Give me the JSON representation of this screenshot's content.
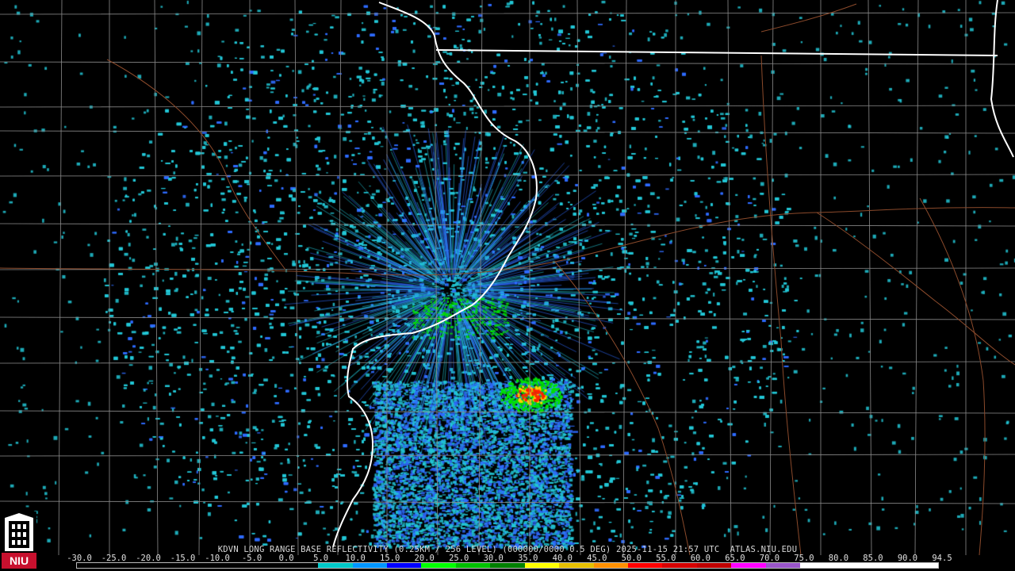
{
  "product": {
    "station": "KDVN",
    "description": "LONG RANGE BASE REFLECTIVITY (0.25KM / 256 LEVEL) (000000/0000 0.5 DEG)",
    "timestamp": "2025-11-15 21:57 UTC",
    "source": "ATLAS.NIU.EDU"
  },
  "colorscale": {
    "labels": [
      "-30.0",
      "-25.0",
      "-20.0",
      "-15.0",
      "-10.0",
      "-5.0",
      "0.0",
      "5.0",
      "10.0",
      "15.0",
      "20.0",
      "25.0",
      "30.0",
      "35.0",
      "40.0",
      "45.0",
      "50.0",
      "55.0",
      "60.0",
      "65.0",
      "70.0",
      "75.0",
      "80.0",
      "85.0",
      "90.0",
      "94.5"
    ],
    "colors": [
      "#000000",
      "#000000",
      "#000000",
      "#000000",
      "#000000",
      "#000000",
      "#000000",
      "#00c8c8",
      "#0096ff",
      "#0000ff",
      "#00ff00",
      "#00c000",
      "#008000",
      "#ffff00",
      "#e7c000",
      "#ff9000",
      "#ff0000",
      "#d60000",
      "#c00000",
      "#ff00ff",
      "#9955c9",
      "#ffffff",
      "#ffffff",
      "#ffffff",
      "#ffffff"
    ]
  },
  "logo": {
    "text": "NIU",
    "colors": {
      "red": "#c8102e",
      "white": "#ffffff",
      "black": "#000000"
    }
  },
  "map": {
    "colors": {
      "county": "#8c8c8c",
      "state": "#ffffff",
      "highway": "#8b4a2b",
      "echo_light": "#22c7d6",
      "echo_medium": "#2f6bff",
      "echo_strong": "#00e000",
      "echo_heavy": "#ffd000",
      "echo_core": "#ff2000"
    }
  }
}
